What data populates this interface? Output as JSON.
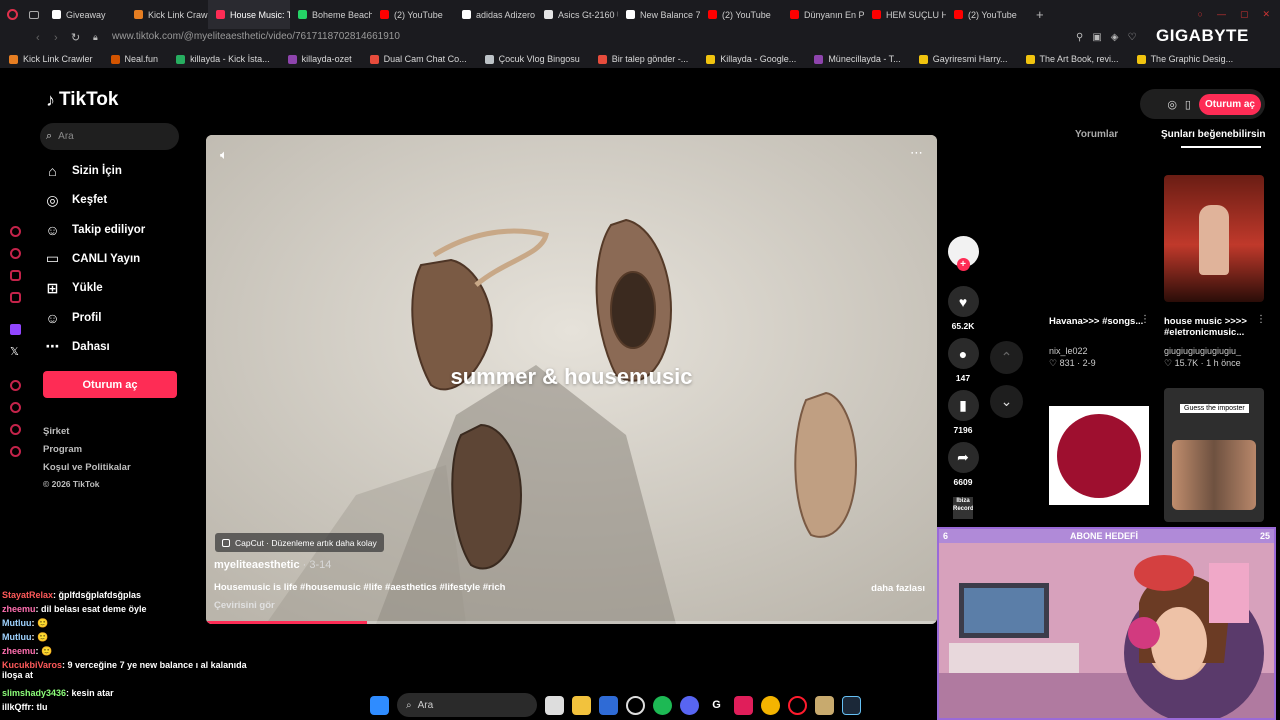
{
  "browser": {
    "tabs": [
      {
        "label": "Giveaway",
        "color": "#ffffff"
      },
      {
        "label": "Kick Link Crawl",
        "color": "#e67e22"
      },
      {
        "label": "House Music: The Rhy",
        "color": "#fe2c55",
        "active": true
      },
      {
        "label": "Boheme Beach",
        "color": "#25d366"
      },
      {
        "label": "(2) YouTube",
        "color": "#ff0000"
      },
      {
        "label": "adidas Adizero",
        "color": "#ffffff"
      },
      {
        "label": "Asics Gt-2160 U",
        "color": "#e5e5e5"
      },
      {
        "label": "New Balance 74",
        "color": "#ffffff"
      },
      {
        "label": "(2) YouTube",
        "color": "#ff0000"
      },
      {
        "label": "Dünyanın En Pa",
        "color": "#ff0000"
      },
      {
        "label": "HEM SUÇLU HE",
        "color": "#ff0000"
      },
      {
        "label": "(2) YouTube",
        "color": "#ff0000"
      }
    ],
    "url": "www.tiktok.com/@myeliteaesthetic/video/7617118702814661910",
    "overlay_brand": "GIGABYTE",
    "bookmarks": [
      "Kick Link Crawler",
      "Neal.fun",
      "killayda - Kick İsta...",
      "killayda-ozet",
      "Dual Cam Chat Co...",
      "Çocuk Vlog Bingosu",
      "Bir talep gönder -...",
      "Killayda - Google...",
      "Münecillayda - T...",
      "Gayriresmi Harry...",
      "The Art Book, revi...",
      "The Graphic Desig..."
    ]
  },
  "tiktok": {
    "logo": "TikTok",
    "search_placeholder": "Ara",
    "nav": [
      {
        "label": "Sizin İçin",
        "icon": "home-icon"
      },
      {
        "label": "Keşfet",
        "icon": "compass-icon"
      },
      {
        "label": "Takip ediliyor",
        "icon": "following-icon"
      },
      {
        "label": "CANLI Yayın",
        "icon": "live-icon"
      },
      {
        "label": "Yükle",
        "icon": "upload-icon"
      },
      {
        "label": "Profil",
        "icon": "profile-icon"
      },
      {
        "label": "Dahası",
        "icon": "more-icon"
      }
    ],
    "login_button": "Oturum aç",
    "footer": [
      "Şirket",
      "Program",
      "Koşul ve Politikalar",
      "© 2026 TikTok"
    ]
  },
  "video": {
    "overlay_title": "summer & housemusic",
    "capcut_label": "CapCut · Düzenleme artık daha kolay",
    "author": "myeliteaesthetic",
    "date": " · 3-14",
    "description": "Housemusic is life #housemusic #life #aesthetics #lifestyle #rich",
    "more_label": "daha fazlası",
    "translate_label": "Çevirisini gör",
    "progress": 0.22
  },
  "actions": {
    "likes": "65.2K",
    "comments": "147",
    "saves": "7196",
    "shares": "6609",
    "brand": "Ibiza Records"
  },
  "right_panel": {
    "login_button": "Oturum aç",
    "tab_comments": "Yorumlar",
    "tab_suggested": "Şunları beğenebilirsin",
    "cards": [
      {
        "title": "Havana>>> #songs...",
        "author": "nix_le022",
        "likes": "831",
        "date": "2-9"
      },
      {
        "title": "house music >>>> #eletronicmusic...",
        "author": "giugiugiugiugiugiu_",
        "likes": "15.7K",
        "date": "1 h önce"
      },
      {
        "title": "",
        "thumb_text": "Guess the imposter"
      }
    ]
  },
  "stream": {
    "goal_label": "ABONE HEDEFİ",
    "goal_current": "6",
    "goal_target": "25"
  },
  "chat": [
    {
      "user": "StayatRelax",
      "msg": "ğplfdsğplafdsğplas",
      "color": "#ff5a5a"
    },
    {
      "user": "zheemu",
      "msg": "dil belası esat deme öyle",
      "color": "#ff6fb0"
    },
    {
      "user": "Mutluu",
      "msg": "🙂",
      "color": "#9fd3ff"
    },
    {
      "user": "Mutluu",
      "msg": "🙂",
      "color": "#9fd3ff"
    },
    {
      "user": "zheemu",
      "msg": "🙂",
      "color": "#ff6fb0"
    },
    {
      "user": "KucukbiVaros",
      "msg": "9 verceğine 7 ye new balance ı al kalanıda iloşa at",
      "color": "#ff5a5a"
    },
    {
      "user": "slimshady3436",
      "msg": "kesin atar",
      "color": "#8dff7a"
    },
    {
      "user": "illkQffr",
      "msg": "tlu",
      "color": "#ffffff"
    }
  ],
  "taskbar": {
    "search_placeholder": "Ara"
  }
}
